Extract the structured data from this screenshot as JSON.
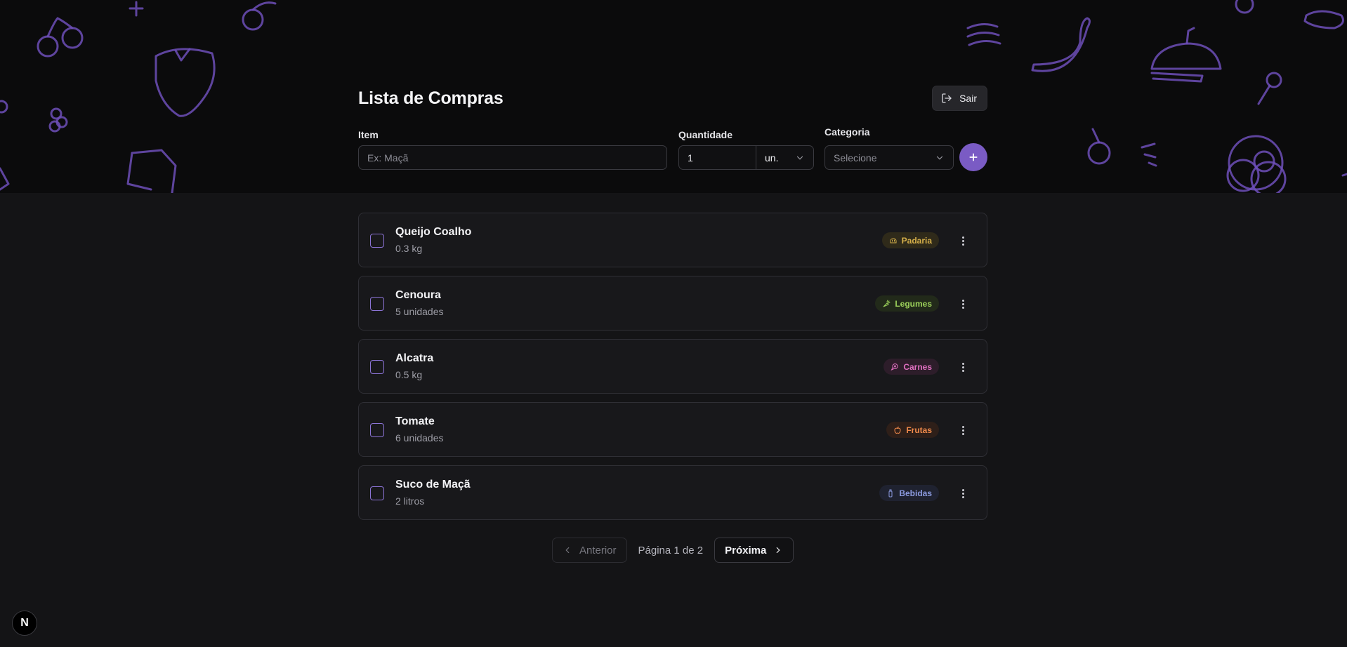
{
  "header": {
    "title": "Lista de Compras",
    "logout_label": "Sair"
  },
  "form": {
    "item_label": "Item",
    "item_placeholder": "Ex: Maçã",
    "quantity_label": "Quantidade",
    "quantity_value": "1",
    "unit_value": "un.",
    "category_label": "Categoria",
    "category_placeholder": "Selecione"
  },
  "items": [
    {
      "name": "Queijo Coalho",
      "qty": "0.3 kg",
      "category": "Padaria",
      "icon": "bread-icon",
      "color": "#d6b04a",
      "bg": "#2f2a1a"
    },
    {
      "name": "Cenoura",
      "qty": "5 unidades",
      "category": "Legumes",
      "icon": "carrot-icon",
      "color": "#9bcf5a",
      "bg": "#222a1a"
    },
    {
      "name": "Alcatra",
      "qty": "0.5 kg",
      "category": "Carnes",
      "icon": "beef-icon",
      "color": "#e06fc0",
      "bg": "#2d1d2a"
    },
    {
      "name": "Tomate",
      "qty": "6 unidades",
      "category": "Frutas",
      "icon": "apple-icon",
      "color": "#f08a4b",
      "bg": "#2e1f19"
    },
    {
      "name": "Suco de Maçã",
      "qty": "2 litros",
      "category": "Bebidas",
      "icon": "bottle-icon",
      "color": "#8b9adf",
      "bg": "#1f2230"
    }
  ],
  "pagination": {
    "prev_label": "Anterior",
    "page_info": "Página 1 de 2",
    "next_label": "Próxima"
  },
  "logo_letter": "N"
}
